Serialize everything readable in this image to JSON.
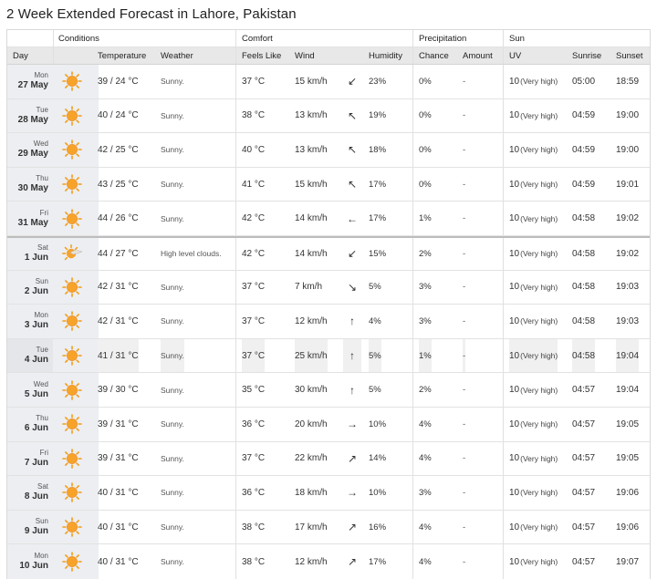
{
  "title": "2 Week Extended Forecast in Lahore, Pakistan",
  "groups": {
    "conditions": "Conditions",
    "comfort": "Comfort",
    "precipitation": "Precipitation",
    "sun": "Sun"
  },
  "headers": {
    "day": "Day",
    "temperature": "Temperature",
    "weather": "Weather",
    "feels_like": "Feels Like",
    "wind": "Wind",
    "humidity": "Humidity",
    "chance": "Chance",
    "amount": "Amount",
    "uv": "UV",
    "sunrise": "Sunrise",
    "sunset": "Sunset"
  },
  "colors": {
    "sun": "#f39c12",
    "header_bg": "#e8e8e8",
    "day_bg": "#eceef1"
  },
  "rows": [
    {
      "dow": "Mon",
      "dm": "27 May",
      "icon": "sunny-icon",
      "temp": "39 / 24 °C",
      "weather": "Sunny.",
      "feels": "37 °C",
      "wind": "15 km/h",
      "dir": "↙",
      "hum": "23%",
      "chance": "0%",
      "amount": "-",
      "uv": "10",
      "uvq": "(Very high)",
      "sunrise": "05:00",
      "sunset": "18:59"
    },
    {
      "dow": "Tue",
      "dm": "28 May",
      "icon": "sunny-icon",
      "temp": "40 / 24 °C",
      "weather": "Sunny.",
      "feels": "38 °C",
      "wind": "13 km/h",
      "dir": "↖",
      "hum": "19%",
      "chance": "0%",
      "amount": "-",
      "uv": "10",
      "uvq": "(Very high)",
      "sunrise": "04:59",
      "sunset": "19:00"
    },
    {
      "dow": "Wed",
      "dm": "29 May",
      "icon": "sunny-icon",
      "temp": "42 / 25 °C",
      "weather": "Sunny.",
      "feels": "40 °C",
      "wind": "13 km/h",
      "dir": "↖",
      "hum": "18%",
      "chance": "0%",
      "amount": "-",
      "uv": "10",
      "uvq": "(Very high)",
      "sunrise": "04:59",
      "sunset": "19:00"
    },
    {
      "dow": "Thu",
      "dm": "30 May",
      "icon": "sunny-icon",
      "temp": "43 / 25 °C",
      "weather": "Sunny.",
      "feels": "41 °C",
      "wind": "15 km/h",
      "dir": "↖",
      "hum": "17%",
      "chance": "0%",
      "amount": "-",
      "uv": "10",
      "uvq": "(Very high)",
      "sunrise": "04:59",
      "sunset": "19:01"
    },
    {
      "dow": "Fri",
      "dm": "31 May",
      "icon": "sunny-icon",
      "temp": "44 / 26 °C",
      "weather": "Sunny.",
      "feels": "42 °C",
      "wind": "14 km/h",
      "dir": "←",
      "hum": "17%",
      "chance": "1%",
      "amount": "-",
      "uv": "10",
      "uvq": "(Very high)",
      "sunrise": "04:58",
      "sunset": "19:02"
    },
    {
      "dow": "Sat",
      "dm": "1 Jun",
      "icon": "high-clouds-icon",
      "temp": "44 / 27 °C",
      "weather": "High level clouds.",
      "feels": "42 °C",
      "wind": "14 km/h",
      "dir": "↙",
      "hum": "15%",
      "chance": "2%",
      "amount": "-",
      "uv": "10",
      "uvq": "(Very high)",
      "sunrise": "04:58",
      "sunset": "19:02"
    },
    {
      "dow": "Sun",
      "dm": "2 Jun",
      "icon": "sunny-icon",
      "temp": "42 / 31 °C",
      "weather": "Sunny.",
      "feels": "37 °C",
      "wind": "7 km/h",
      "dir": "↘",
      "hum": "5%",
      "chance": "3%",
      "amount": "-",
      "uv": "10",
      "uvq": "(Very high)",
      "sunrise": "04:58",
      "sunset": "19:03"
    },
    {
      "dow": "Mon",
      "dm": "3 Jun",
      "icon": "sunny-icon",
      "temp": "42 / 31 °C",
      "weather": "Sunny.",
      "feels": "37 °C",
      "wind": "12 km/h",
      "dir": "↑",
      "hum": "4%",
      "chance": "3%",
      "amount": "-",
      "uv": "10",
      "uvq": "(Very high)",
      "sunrise": "04:58",
      "sunset": "19:03"
    },
    {
      "dow": "Tue",
      "dm": "4 Jun",
      "icon": "sunny-icon",
      "temp": "41 / 31 °C",
      "weather": "Sunny.",
      "feels": "37 °C",
      "wind": "25 km/h",
      "dir": "↑",
      "hum": "5%",
      "chance": "1%",
      "amount": "-",
      "uv": "10",
      "uvq": "(Very high)",
      "sunrise": "04:58",
      "sunset": "19:04"
    },
    {
      "dow": "Wed",
      "dm": "5 Jun",
      "icon": "sunny-icon",
      "temp": "39 / 30 °C",
      "weather": "Sunny.",
      "feels": "35 °C",
      "wind": "30 km/h",
      "dir": "↑",
      "hum": "5%",
      "chance": "2%",
      "amount": "-",
      "uv": "10",
      "uvq": "(Very high)",
      "sunrise": "04:57",
      "sunset": "19:04"
    },
    {
      "dow": "Thu",
      "dm": "6 Jun",
      "icon": "sunny-icon",
      "temp": "39 / 31 °C",
      "weather": "Sunny.",
      "feels": "36 °C",
      "wind": "20 km/h",
      "dir": "→",
      "hum": "10%",
      "chance": "4%",
      "amount": "-",
      "uv": "10",
      "uvq": "(Very high)",
      "sunrise": "04:57",
      "sunset": "19:05"
    },
    {
      "dow": "Fri",
      "dm": "7 Jun",
      "icon": "sunny-icon",
      "temp": "39 / 31 °C",
      "weather": "Sunny.",
      "feels": "37 °C",
      "wind": "22 km/h",
      "dir": "↗",
      "hum": "14%",
      "chance": "4%",
      "amount": "-",
      "uv": "10",
      "uvq": "(Very high)",
      "sunrise": "04:57",
      "sunset": "19:05"
    },
    {
      "dow": "Sat",
      "dm": "8 Jun",
      "icon": "sunny-icon",
      "temp": "40 / 31 °C",
      "weather": "Sunny.",
      "feels": "36 °C",
      "wind": "18 km/h",
      "dir": "→",
      "hum": "10%",
      "chance": "3%",
      "amount": "-",
      "uv": "10",
      "uvq": "(Very high)",
      "sunrise": "04:57",
      "sunset": "19:06"
    },
    {
      "dow": "Sun",
      "dm": "9 Jun",
      "icon": "sunny-icon",
      "temp": "40 / 31 °C",
      "weather": "Sunny.",
      "feels": "38 °C",
      "wind": "17 km/h",
      "dir": "↗",
      "hum": "16%",
      "chance": "4%",
      "amount": "-",
      "uv": "10",
      "uvq": "(Very high)",
      "sunrise": "04:57",
      "sunset": "19:06"
    },
    {
      "dow": "Mon",
      "dm": "10 Jun",
      "icon": "sunny-icon",
      "temp": "40 / 31 °C",
      "weather": "Sunny.",
      "feels": "38 °C",
      "wind": "12 km/h",
      "dir": "↗",
      "hum": "17%",
      "chance": "4%",
      "amount": "-",
      "uv": "10",
      "uvq": "(Very high)",
      "sunrise": "04:57",
      "sunset": "19:07"
    }
  ]
}
